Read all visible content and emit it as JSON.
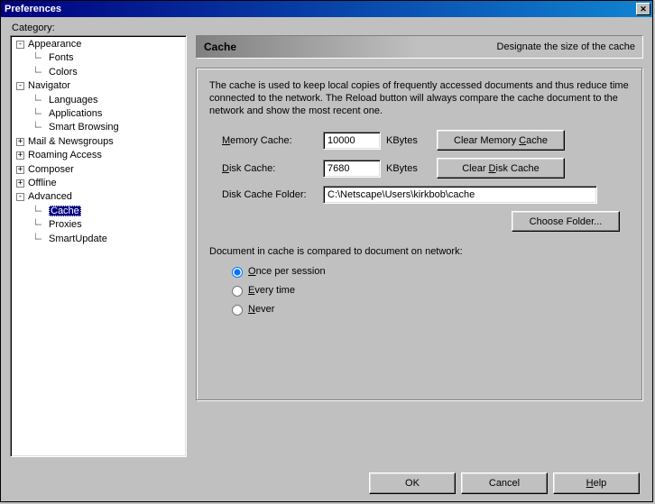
{
  "window": {
    "title": "Preferences"
  },
  "category_label": "Category:",
  "tree": {
    "appearance": {
      "label": "Appearance",
      "fonts": "Fonts",
      "colors": "Colors"
    },
    "navigator": {
      "label": "Navigator",
      "languages": "Languages",
      "applications": "Applications",
      "smart": "Smart Browsing"
    },
    "mail": "Mail & Newsgroups",
    "roaming": "Roaming Access",
    "composer": "Composer",
    "offline": "Offline",
    "advanced": {
      "label": "Advanced",
      "cache": "Cache",
      "proxies": "Proxies",
      "smartupdate": "SmartUpdate"
    }
  },
  "panel": {
    "title": "Cache",
    "subtitle": "Designate the size of the cache",
    "description": "The cache is used to keep local copies of frequently accessed documents and thus reduce time connected to the network. The Reload button will always compare the cache document to the network and show the most recent one.",
    "mem_label_pre": "M",
    "mem_label_post": "emory Cache:",
    "mem_value": "10000",
    "kbytes": "KBytes",
    "clear_mem_pre": "Clear Memory ",
    "clear_mem_u": "C",
    "clear_mem_post": "ache",
    "disk_label_pre": "D",
    "disk_label_post": "isk Cache:",
    "disk_value": "7680",
    "clear_disk_pre": "Clear ",
    "clear_disk_u": "D",
    "clear_disk_post": "isk Cache",
    "folder_label": "Disk Cache Folder:",
    "folder_value": "C:\\Netscape\\Users\\kirkbob\\cache",
    "choose": "Choose Folder...",
    "compare_label": "Document in cache is compared to document on network:",
    "once_u": "O",
    "once_post": "nce per session",
    "every_u": "E",
    "every_post": "very time",
    "never_u": "N",
    "never_post": "ever"
  },
  "buttons": {
    "ok": "OK",
    "cancel": "Cancel",
    "help_u": "H",
    "help_post": "elp"
  }
}
